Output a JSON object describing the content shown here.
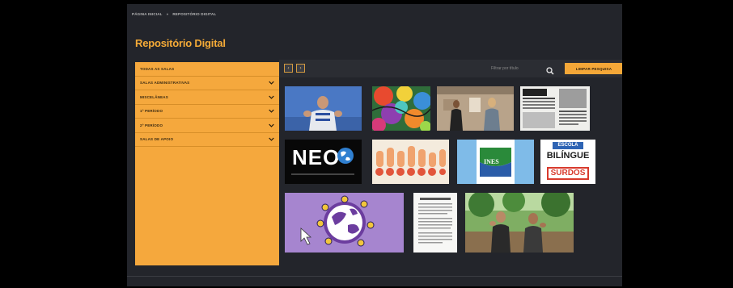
{
  "breadcrumb": {
    "home": "PÁGINA INICIAL",
    "sep": "»",
    "current": "REPOSITÓRIO DIGITAL"
  },
  "page": {
    "title": "Repositório Digital"
  },
  "sidebar": {
    "items": [
      {
        "label": "TODAS AS SALAS",
        "expandable": false
      },
      {
        "label": "SALAS ADMINISTRATIVAS",
        "expandable": true
      },
      {
        "label": "MISCELÂNEAS",
        "expandable": true
      },
      {
        "label": "1º PERÍODO",
        "expandable": true
      },
      {
        "label": "2º PERÍODO",
        "expandable": true
      },
      {
        "label": "SALAS DE APOIO",
        "expandable": true
      }
    ]
  },
  "toolbar": {
    "prev_label": "‹",
    "next_label": "›",
    "search_placeholder": "Filtrar por título",
    "clear_label": "LIMPAR PESQUISA"
  },
  "tiles": {
    "neo": {
      "text": "NEO"
    },
    "ines": {
      "text": "INES"
    },
    "bilingue": {
      "line1": "ESCOLA",
      "line2": "BILÍNGUE",
      "line3": "SURDOS"
    }
  },
  "colors": {
    "accent": "#f4aa37",
    "panel": "#23252b",
    "sidebar": "#f5a83d"
  }
}
